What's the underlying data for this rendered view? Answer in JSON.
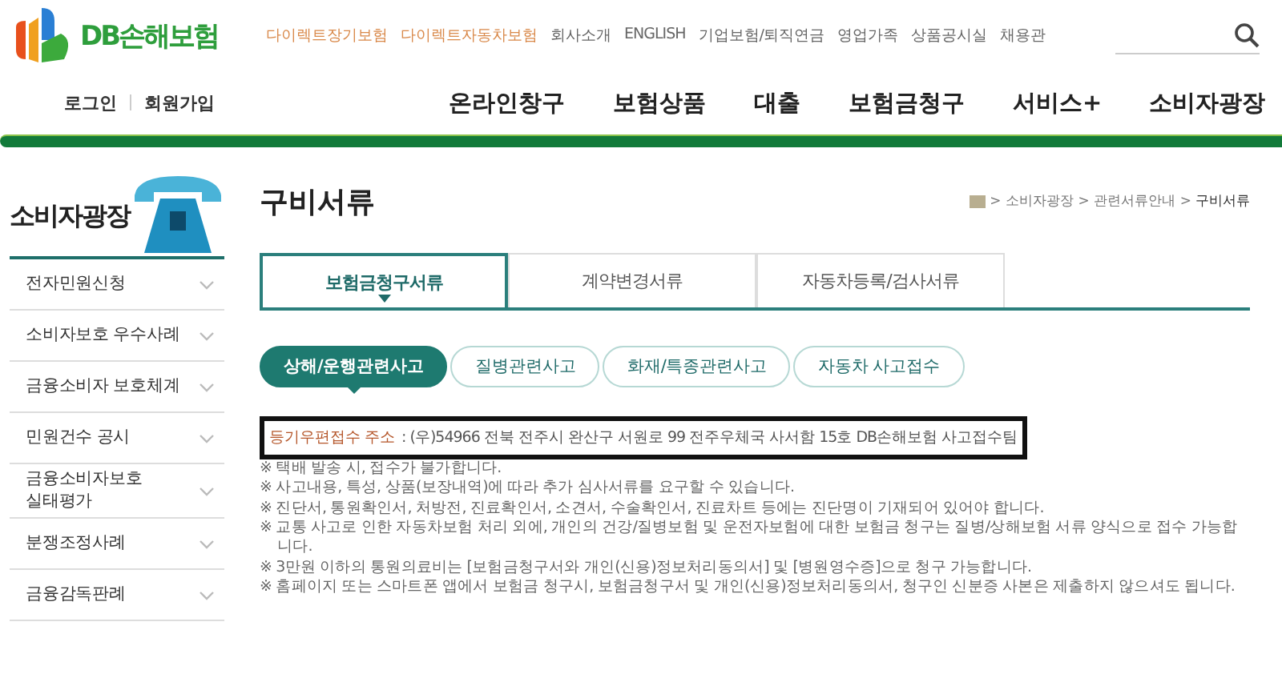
{
  "logo": {
    "text": "DB손해보험"
  },
  "utility_links": [
    {
      "label": "다이렉트장기보험",
      "color": "#d9894a"
    },
    {
      "label": "다이렉트자동차보험",
      "color": "#d9894a"
    },
    {
      "label": "회사소개",
      "color": "#666666"
    },
    {
      "label": "ENGLISH",
      "color": "#666666"
    },
    {
      "label": "기업보험/퇴직연금",
      "color": "#666666"
    },
    {
      "label": "영업가족",
      "color": "#666666"
    },
    {
      "label": "상품공시실",
      "color": "#666666"
    },
    {
      "label": "채용관",
      "color": "#666666"
    }
  ],
  "account_links": [
    "로그인",
    "회원가입"
  ],
  "main_nav": [
    "온라인창구",
    "보험상품",
    "대출",
    "보험금청구",
    "서비스+",
    "소비자광장"
  ],
  "sidebar": {
    "title": "소비자광장",
    "items": [
      "전자민원신청",
      "소비자보호 우수사례",
      "금융소비자 보호체계",
      "민원건수 공시",
      "금융소비자보호\n실태평가",
      "분쟁조정사례",
      "금융감독판례"
    ]
  },
  "page_title": "구비서류",
  "breadcrumb": [
    "소비자광장",
    "관련서류안내",
    "구비서류"
  ],
  "breadcrumb_separator": ">",
  "tabs": [
    {
      "label": "보험금청구서류",
      "selected": true
    },
    {
      "label": "계약변경서류",
      "selected": false
    },
    {
      "label": "자동차등록/검사서류",
      "selected": false
    }
  ],
  "sub_tabs": [
    {
      "label": "상해/운행관련사고",
      "selected": true
    },
    {
      "label": "질병관련사고",
      "selected": false
    },
    {
      "label": "화재/특종관련사고",
      "selected": false
    },
    {
      "label": "자동차 사고접수",
      "selected": false
    }
  ],
  "address": {
    "label": "등기우편접수 주소",
    "text": ": (우)54966 전북 전주시 완산구 서원로 99 전주우체국 사서함 15호 DB손해보험 사고접수팀"
  },
  "notes": [
    "※ 택배 발송 시, 접수가 불가합니다.",
    "※ 사고내용, 특성, 상품(보장내역)에 따라 추가 심사서류를 요구할 수 있습니다.",
    "※ 진단서, 통원확인서, 처방전, 진료확인서, 소견서, 수술확인서, 진료차트 등에는 진단명이 기재되어 있어야 합니다.",
    "※ 교통 사고로 인한 자동차보험 처리 외에, 개인의 건강/질병보험 및 운전자보험에 대한 보험금 청구는 질병/상해보험 서류 양식으로 접수 가능합니다.",
    "※ 3만원 이하의 통원의료비는 [보험금청구서와 개인(신용)정보처리동의서] 및 [병원영수증]으로 청구 가능합니다.",
    "※ 홈페이지 또는 스마트폰 앱에서 보험금 청구시, 보험금청구서 및 개인(신용)정보처리동의서, 청구인 신분증 사본은 제출하지 않으셔도 됩니다."
  ]
}
